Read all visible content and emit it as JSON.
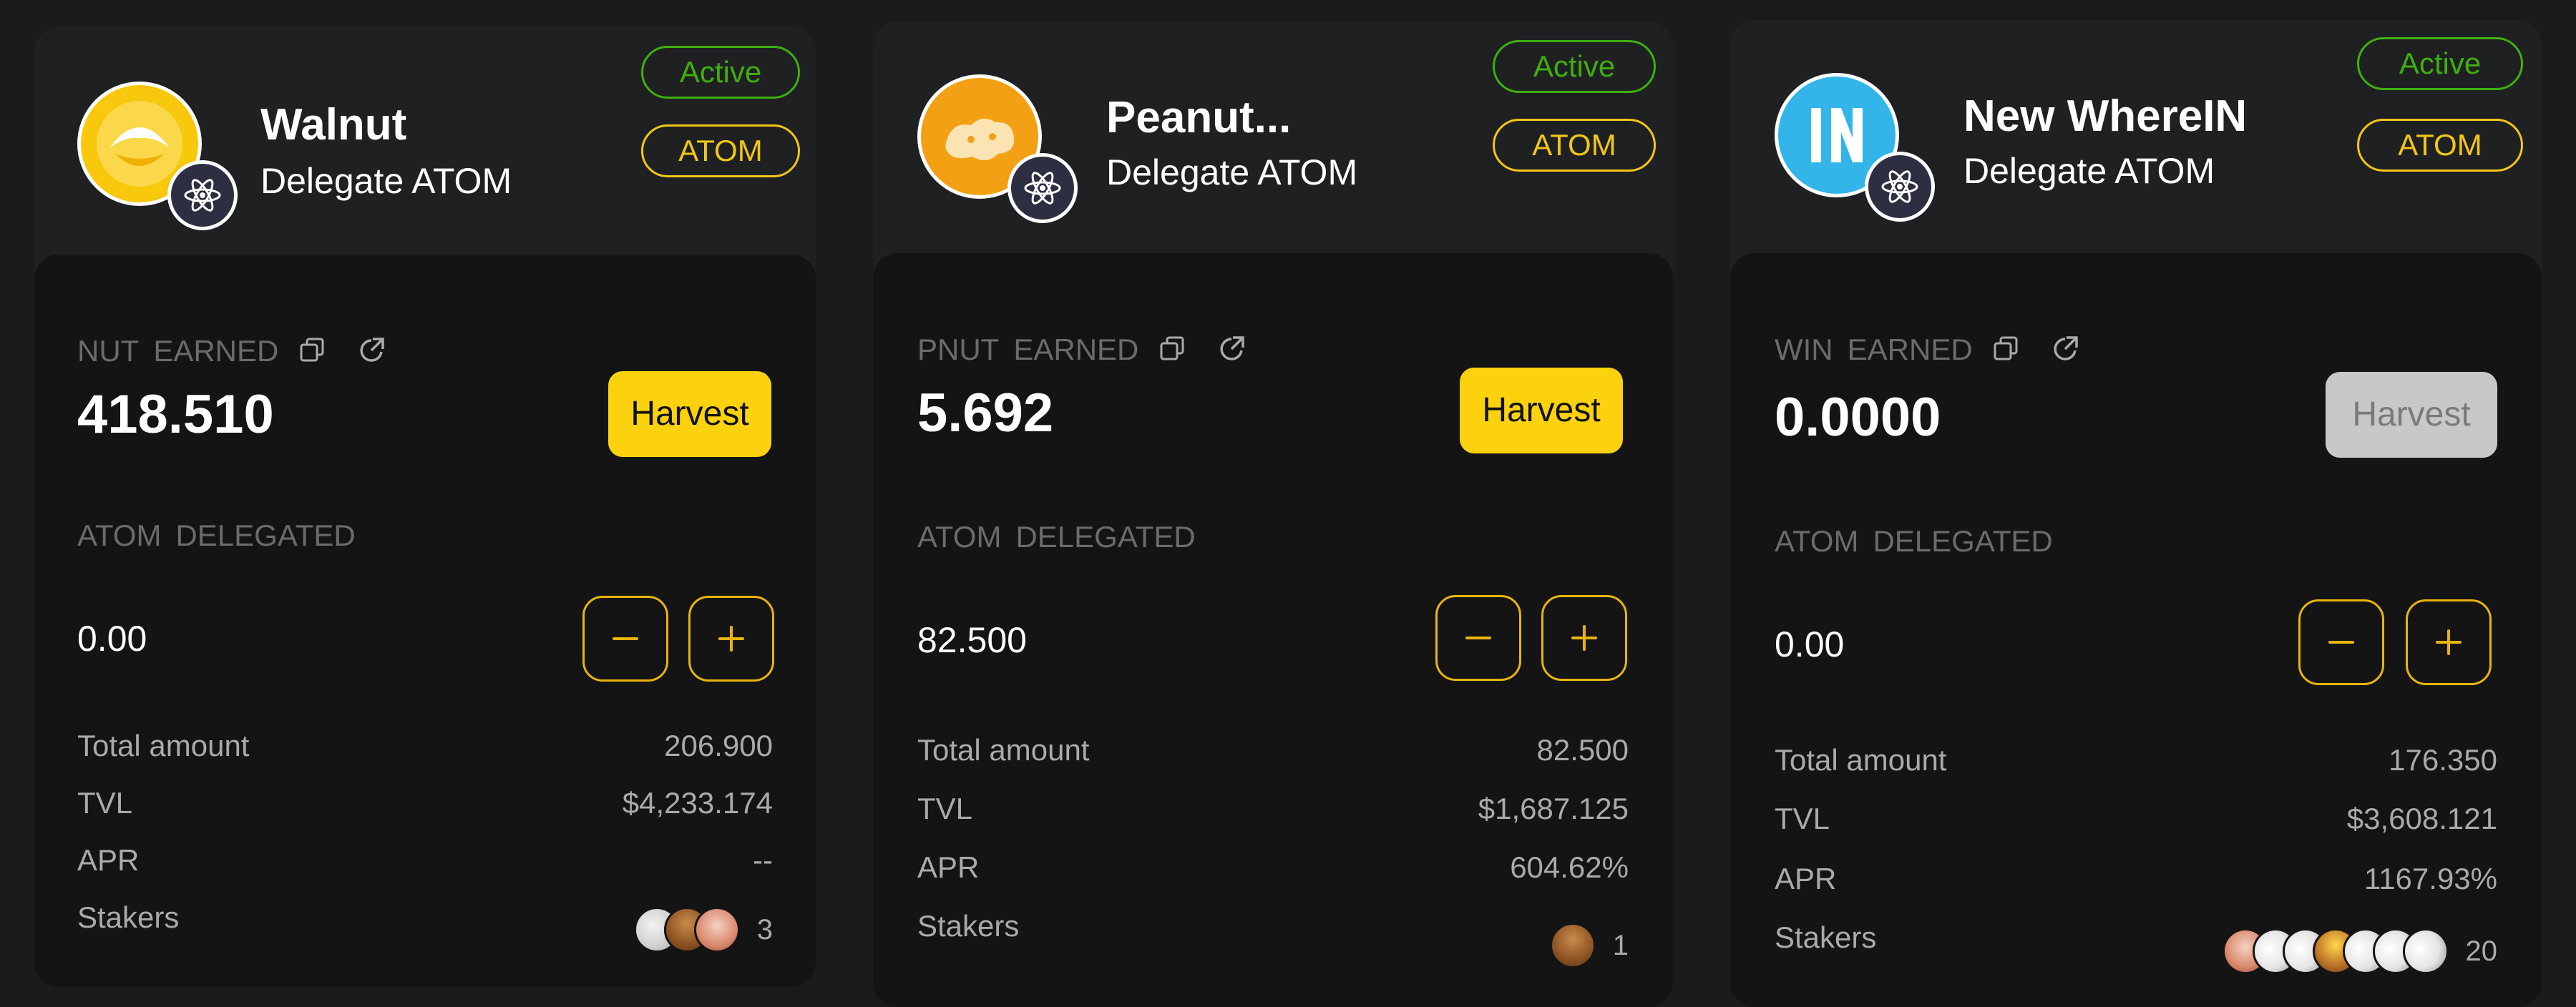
{
  "pools": [
    {
      "name": "Walnut",
      "subtitle": "Delegate ATOM",
      "status_badge": "Active",
      "token_badge": "ATOM",
      "earned_token": "NUT",
      "earned_label": "EARNED",
      "earned_value": "418.510",
      "harvest_label": "Harvest",
      "harvest_enabled": true,
      "delegated_token": "ATOM",
      "delegated_label": "DELEGATED",
      "delegated_value": "0.00",
      "minus_symbol": "−",
      "plus_symbol": "+",
      "stats": {
        "total_amount_label": "Total amount",
        "total_amount": "206.900",
        "tvl_label": "TVL",
        "tvl": "$4,233.174",
        "apr_label": "APR",
        "apr": "--",
        "stakers_label": "Stakers",
        "stakers": "3"
      },
      "logo_color": "#f7c80b"
    },
    {
      "name": "Peanut...",
      "subtitle": "Delegate ATOM",
      "status_badge": "Active",
      "token_badge": "ATOM",
      "earned_token": "PNUT",
      "earned_label": "EARNED",
      "earned_value": "5.692",
      "harvest_label": "Harvest",
      "harvest_enabled": true,
      "delegated_token": "ATOM",
      "delegated_label": "DELEGATED",
      "delegated_value": "82.500",
      "minus_symbol": "−",
      "plus_symbol": "+",
      "stats": {
        "total_amount_label": "Total amount",
        "total_amount": "82.500",
        "tvl_label": "TVL",
        "tvl": "$1,687.125",
        "apr_label": "APR",
        "apr": "604.62%",
        "stakers_label": "Stakers",
        "stakers": "1"
      },
      "logo_color": "#f3a014"
    },
    {
      "name": "New WhereIN",
      "subtitle": "Delegate ATOM",
      "status_badge": "Active",
      "token_badge": "ATOM",
      "earned_token": "WIN",
      "earned_label": "EARNED",
      "earned_value": "0.0000",
      "harvest_label": "Harvest",
      "harvest_enabled": false,
      "delegated_token": "ATOM",
      "delegated_label": "DELEGATED",
      "delegated_value": "0.00",
      "minus_symbol": "−",
      "plus_symbol": "+",
      "stats": {
        "total_amount_label": "Total amount",
        "total_amount": "176.350",
        "tvl_label": "TVL",
        "tvl": "$3,608.121",
        "apr_label": "APR",
        "apr": "1167.93%",
        "stakers_label": "Stakers",
        "stakers": "20"
      },
      "logo_color": "#33b5ea"
    }
  ],
  "colors": {
    "active_green": "#3fae0e",
    "accent_yellow": "#f2c616",
    "harvest_yellow": "#fcd20f",
    "stepper_border": "#e8b40c"
  }
}
